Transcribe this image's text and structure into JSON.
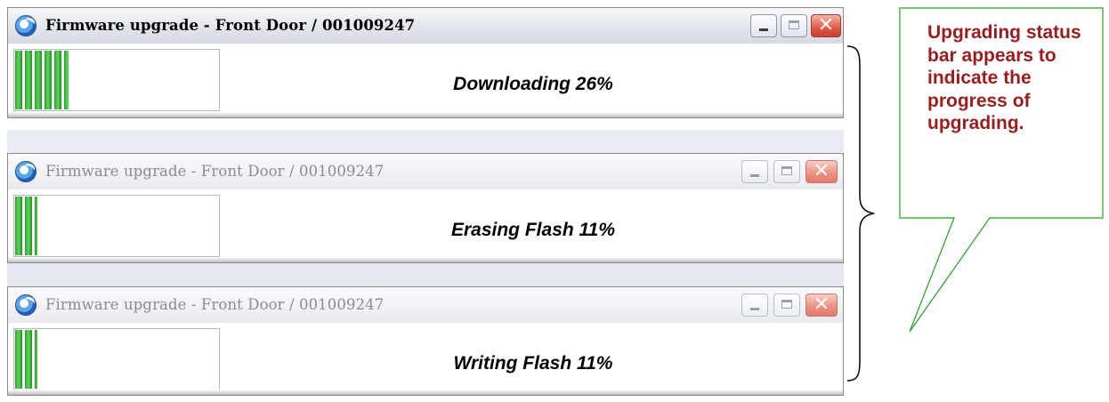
{
  "windows": [
    {
      "title": "Firmware upgrade - Front Door / 001009247",
      "state": "active",
      "status_text": "Downloading 26%",
      "progress_percent": 26,
      "controls": {
        "minimize": "minimize",
        "maximize": "maximize",
        "close": "✕"
      }
    },
    {
      "title": "Firmware upgrade - Front Door / 001009247",
      "state": "inactive",
      "status_text": "Erasing Flash 11%",
      "progress_percent": 11,
      "controls": {
        "minimize": "minimize",
        "maximize": "maximize",
        "close": "✕"
      }
    },
    {
      "title": "Firmware upgrade - Front Door / 001009247",
      "state": "inactive",
      "status_text": "Writing Flash 11%",
      "progress_percent": 11,
      "controls": {
        "minimize": "minimize",
        "maximize": "maximize",
        "close": "✕"
      }
    }
  ],
  "callout": {
    "text": "Upgrading status bar appears to indicate the progress of upgrading.",
    "text_color": "#9b1c1c",
    "border_color": "#22a022"
  },
  "colors": {
    "progress_green": "#29a229",
    "bracket": "#000000"
  },
  "icons": [
    "app-icon",
    "minimize-icon",
    "maximize-icon",
    "close-icon"
  ]
}
